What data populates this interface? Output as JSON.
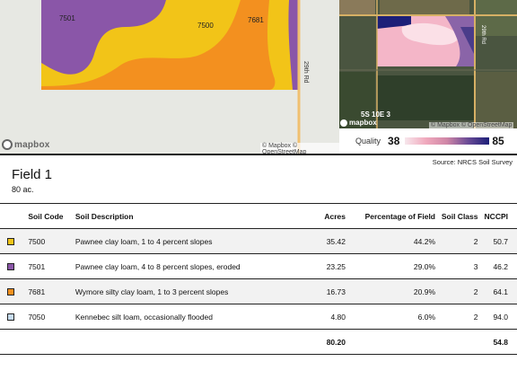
{
  "soil_map": {
    "polygons": [
      {
        "code": "7501",
        "color": "#8a56a8"
      },
      {
        "code": "7500",
        "color": "#f2c418"
      },
      {
        "code": "7681",
        "color": "#f3901f"
      }
    ],
    "labels": [
      "7501",
      "7500",
      "7681"
    ],
    "road_label": "29th Rd",
    "logo": "mapbox",
    "attribution": "© Mapbox © OpenStreetMap"
  },
  "satellite_map": {
    "section_label": "5S 10E 3",
    "road_label": "29th Rd",
    "logo": "mapbox",
    "attribution": "© Mapbox © OpenStreetMap"
  },
  "quality": {
    "label": "Quality",
    "min": "38",
    "max": "85",
    "gradient_colors": [
      "#f7e7ec",
      "#f0a9bd",
      "#cf86a6",
      "#6a4b96",
      "#1c1f78"
    ]
  },
  "source": "Source: NRCS Soil Survey",
  "field": {
    "title": "Field 1",
    "acres": "80 ac."
  },
  "table": {
    "headers": {
      "code": "Soil Code",
      "description": "Soil Description",
      "acres": "Acres",
      "percent": "Percentage of Field",
      "class": "Soil Class",
      "nccpi": "NCCPI"
    },
    "rows": [
      {
        "color": "#f2c418",
        "code": "7500",
        "description": "Pawnee clay loam, 1 to 4 percent slopes",
        "acres": "35.42",
        "percent": "44.2%",
        "class": "2",
        "nccpi": "50.7"
      },
      {
        "color": "#8a56a8",
        "code": "7501",
        "description": "Pawnee clay loam, 4 to 8 percent slopes, eroded",
        "acres": "23.25",
        "percent": "29.0%",
        "class": "3",
        "nccpi": "46.2"
      },
      {
        "color": "#f3901f",
        "code": "7681",
        "description": "Wymore silty clay loam, 1 to 3 percent slopes",
        "acres": "16.73",
        "percent": "20.9%",
        "class": "2",
        "nccpi": "64.1"
      },
      {
        "color": "#c7dcef",
        "code": "7050",
        "description": "Kennebec silt loam, occasionally flooded",
        "acres": "4.80",
        "percent": "6.0%",
        "class": "2",
        "nccpi": "94.0"
      }
    ],
    "total": {
      "acres": "80.20",
      "nccpi": "54.8"
    }
  }
}
